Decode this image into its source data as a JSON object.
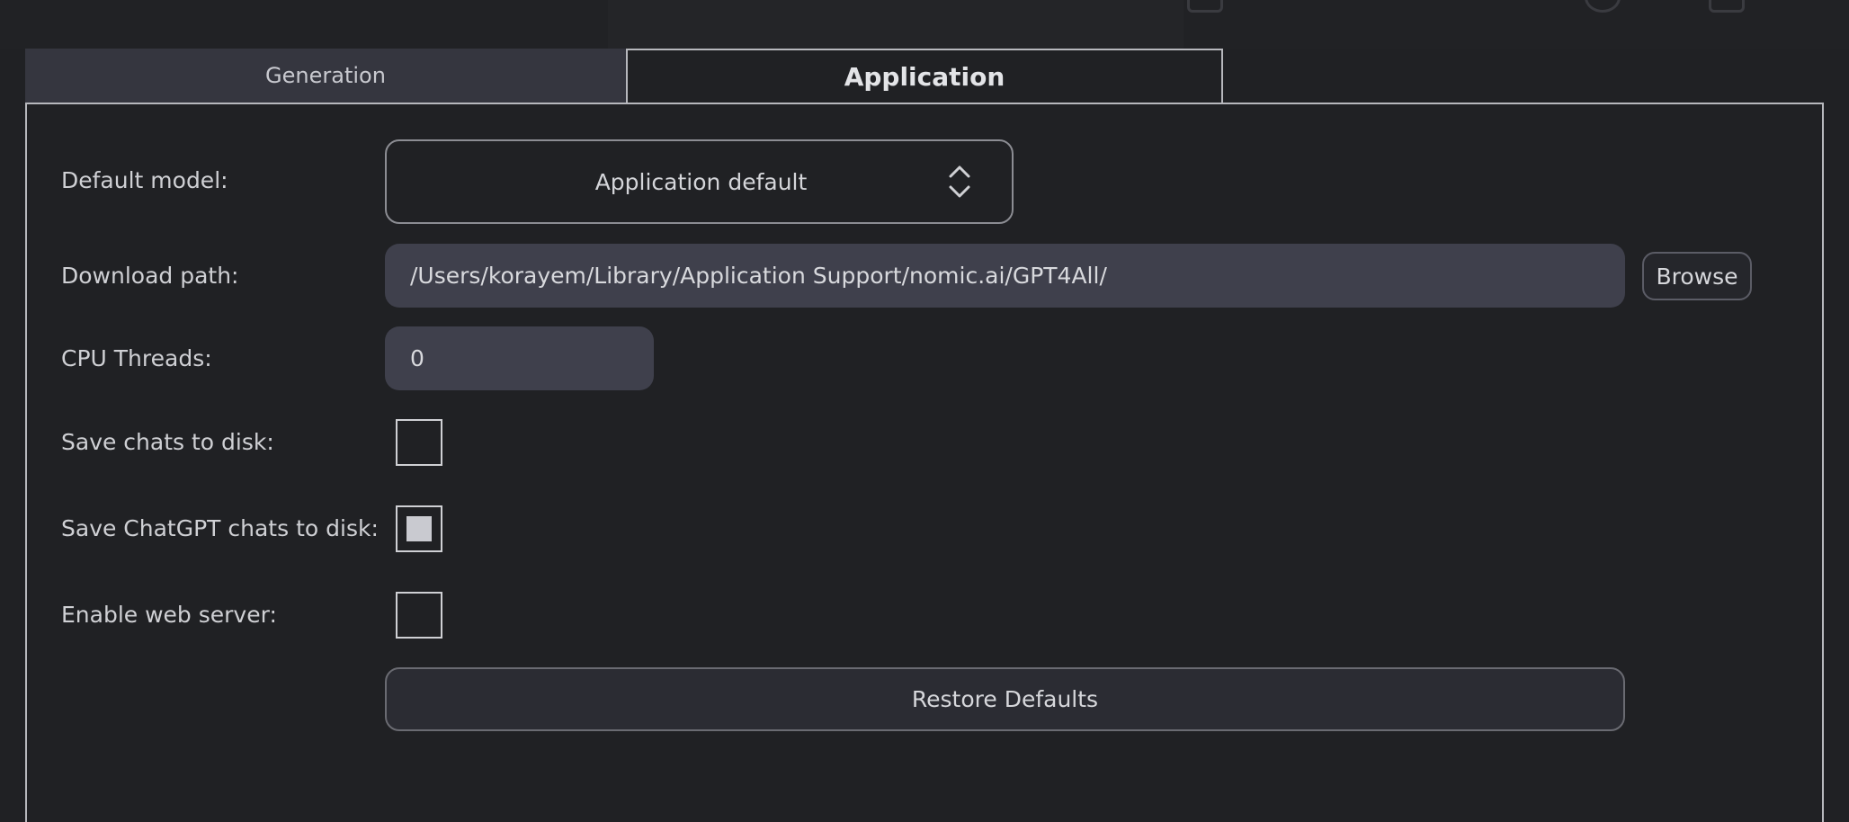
{
  "tabs": {
    "generation_label": "Generation",
    "application_label": "Application",
    "active": "Application"
  },
  "settings": {
    "default_model": {
      "label": "Default model:",
      "value": "Application default"
    },
    "download_path": {
      "label": "Download path:",
      "value": "/Users/korayem/Library/Application Support/nomic.ai/GPT4All/",
      "browse_label": "Browse"
    },
    "cpu_threads": {
      "label": "CPU Threads:",
      "value": "0"
    },
    "save_chats": {
      "label": "Save chats to disk:",
      "checked": false
    },
    "save_chatgpt_chats": {
      "label": "Save ChatGPT chats to disk:",
      "checked": true
    },
    "web_server": {
      "label": "Enable web server:",
      "checked": false
    },
    "restore_label": "Restore Defaults"
  },
  "icons": {
    "combo_arrows": "chevron-up-down-icon"
  },
  "colors": {
    "background": "#202124",
    "tab_inactive": "#35363f",
    "field": "#3f404c",
    "border": "#b7b8bd",
    "checkbox_fill": "#c9cad0"
  }
}
